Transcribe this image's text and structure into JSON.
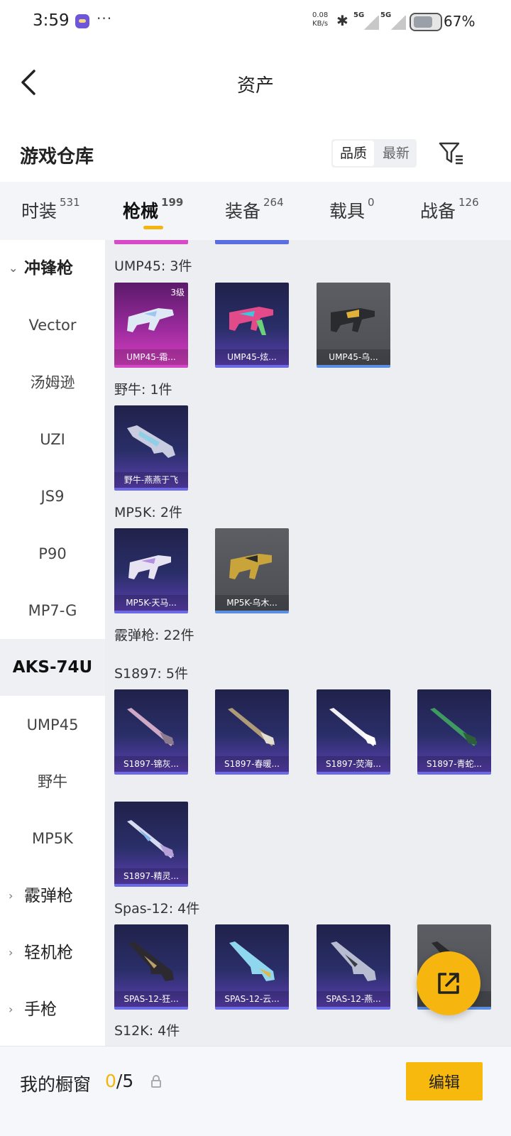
{
  "status_bar": {
    "time": "3:59",
    "dots": "···",
    "speed_value": "0.08",
    "speed_unit": "KB/s",
    "sig1": "5G",
    "sig2": "5G",
    "battery": "67%"
  },
  "header": {
    "title": "资产"
  },
  "section": {
    "title": "游戏仓库",
    "sort_options": [
      "品质",
      "最新"
    ],
    "sort_active": "品质"
  },
  "tabs": [
    {
      "label": "时装",
      "count": "531"
    },
    {
      "label": "枪械",
      "count": "199"
    },
    {
      "label": "装备",
      "count": "264"
    },
    {
      "label": "载具",
      "count": "0"
    },
    {
      "label": "战备",
      "count": "126"
    }
  ],
  "active_tab": "枪械",
  "sidebar": {
    "group_smg": "冲锋枪",
    "items": [
      "Vector",
      "汤姆逊",
      "UZI",
      "JS9",
      "P90",
      "MP7-G",
      "AKS-74U",
      "UMP45",
      "野牛",
      "MP5K"
    ],
    "selected": "AKS-74U",
    "group_shotgun": "霰弹枪",
    "group_lmg": "轻机枪",
    "group_pistol": "手枪"
  },
  "content": {
    "ump45_head": "UMP45: 3件",
    "ump45_cards": [
      "UMP45-霜...",
      "UMP45-炫...",
      "UMP45-乌..."
    ],
    "ump45_tier": "3级",
    "bison_head": "野牛: 1件",
    "bison_cards": [
      "野牛-燕燕于飞"
    ],
    "mp5k_head": "MP5K: 2件",
    "mp5k_cards": [
      "MP5K-天马...",
      "MP5K-乌木..."
    ],
    "shotgun_head": "霰弹枪: 22件",
    "s1897_head": "S1897: 5件",
    "s1897_cards": [
      "S1897-锦灰...",
      "S1897-春暖...",
      "S1897-荧海...",
      "S1897-青蛇...",
      "S1897-精灵..."
    ],
    "spas_head": "Spas-12: 4件",
    "spas_cards": [
      "SPAS-12-狂...",
      "SPAS-12-云...",
      "SPAS-12-燕...",
      "..."
    ],
    "s12k_head": "S12K: 4件"
  },
  "bottom": {
    "label": "我的橱窗",
    "used": "0",
    "sep_total": "/5",
    "edit": "编辑"
  },
  "colors": {
    "accent": "#f7b90e",
    "card_purple": "#2a2e68",
    "card_pink": "#d53fc0",
    "card_gray": "#55575d"
  },
  "icons": {
    "back": "chevron-left-icon",
    "filter": "filter-icon",
    "lock": "lock-icon",
    "share": "share-external-icon"
  }
}
